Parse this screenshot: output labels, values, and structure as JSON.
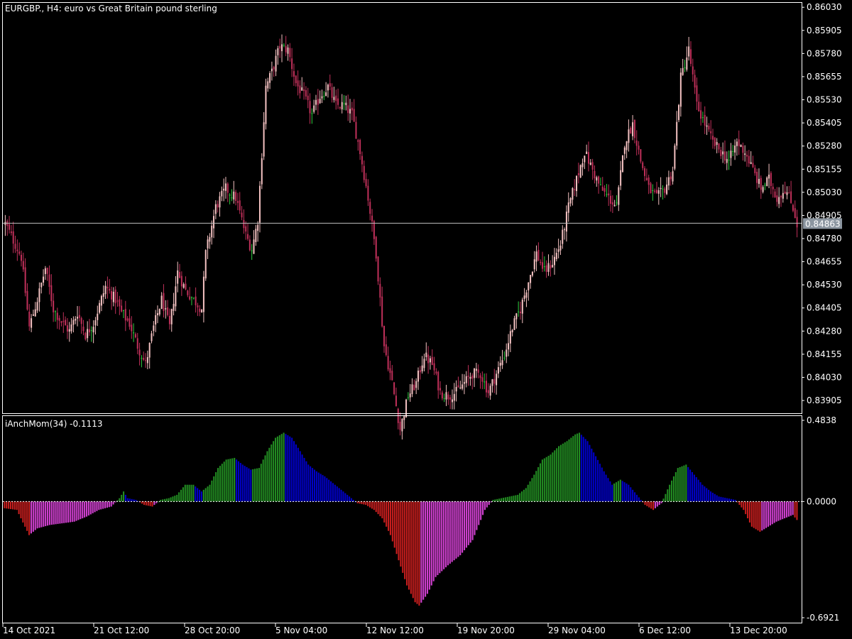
{
  "main_panel": {
    "title": "EURGBP., H4:  euro vs Great Britain pound sterling",
    "price_ticks": [
      "0.86030",
      "0.85905",
      "0.85780",
      "0.85655",
      "0.85530",
      "0.85405",
      "0.85280",
      "0.85155",
      "0.85030",
      "0.84905",
      "0.84780",
      "0.84655",
      "0.84530",
      "0.84405",
      "0.84280",
      "0.84155",
      "0.84030",
      "0.83905"
    ],
    "current_price": "0.84863"
  },
  "indicator_panel": {
    "title": "iAnchMom(34) -0.1113",
    "ticks": [
      "0.4838",
      "0.0000",
      "-0.6921"
    ]
  },
  "time_axis": {
    "labels": [
      "14 Oct 2021",
      "21 Oct 12:00",
      "28 Oct 20:00",
      "5 Nov 04:00",
      "12 Nov 12:00",
      "19 Nov 20:00",
      "29 Nov 04:00",
      "6 Dec 12:00",
      "13 Dec 20:00"
    ]
  },
  "colors": {
    "background": "#000000",
    "frame": "#ffffff",
    "candle_up": "#f4c2c2",
    "candle_down": "#c0305a",
    "candle_doji": "#2ecc40",
    "hist_green": "#228b22",
    "hist_blue": "#0000c8",
    "hist_red": "#c81e1e",
    "hist_magenta": "#d040d0",
    "price_line": "#c0c0c0",
    "price_label_bg": "#8c96a0"
  },
  "chart_data": [
    {
      "type": "candlestick",
      "title": "EURGBP., H4:  euro vs Great Britain pound sterling",
      "ylim": [
        0.8384,
        0.8605
      ],
      "current_price": 0.84863,
      "anchors_close": [
        [
          0,
          0.8486
        ],
        [
          8,
          0.8468
        ],
        [
          12,
          0.843
        ],
        [
          16,
          0.8445
        ],
        [
          20,
          0.8462
        ],
        [
          24,
          0.844
        ],
        [
          28,
          0.8433
        ],
        [
          32,
          0.8428
        ],
        [
          36,
          0.8438
        ],
        [
          40,
          0.8426
        ],
        [
          44,
          0.8432
        ],
        [
          50,
          0.8452
        ],
        [
          55,
          0.8445
        ],
        [
          58,
          0.8438
        ],
        [
          62,
          0.8432
        ],
        [
          66,
          0.842
        ],
        [
          70,
          0.841
        ],
        [
          74,
          0.843
        ],
        [
          78,
          0.8445
        ],
        [
          82,
          0.843
        ],
        [
          86,
          0.846
        ],
        [
          90,
          0.845
        ],
        [
          94,
          0.8445
        ],
        [
          98,
          0.844
        ],
        [
          100,
          0.847
        ],
        [
          105,
          0.8495
        ],
        [
          110,
          0.8505
        ],
        [
          115,
          0.85
        ],
        [
          120,
          0.848
        ],
        [
          123,
          0.8472
        ],
        [
          126,
          0.8488
        ],
        [
          130,
          0.856
        ],
        [
          133,
          0.8568
        ],
        [
          137,
          0.8582
        ],
        [
          141,
          0.858
        ],
        [
          145,
          0.8562
        ],
        [
          149,
          0.8555
        ],
        [
          153,
          0.8545
        ],
        [
          157,
          0.8555
        ],
        [
          161,
          0.856
        ],
        [
          165,
          0.855
        ],
        [
          169,
          0.855
        ],
        [
          173,
          0.8545
        ],
        [
          177,
          0.8525
        ],
        [
          181,
          0.85
        ],
        [
          185,
          0.847
        ],
        [
          189,
          0.842
        ],
        [
          193,
          0.84
        ],
        [
          197,
          0.8375
        ],
        [
          201,
          0.8393
        ],
        [
          205,
          0.84
        ],
        [
          209,
          0.8415
        ],
        [
          213,
          0.841
        ],
        [
          217,
          0.8395
        ],
        [
          221,
          0.8393
        ],
        [
          225,
          0.8395
        ],
        [
          229,
          0.84
        ],
        [
          233,
          0.8405
        ],
        [
          237,
          0.8405
        ],
        [
          241,
          0.8395
        ],
        [
          245,
          0.8405
        ],
        [
          249,
          0.8415
        ],
        [
          253,
          0.843
        ],
        [
          257,
          0.844
        ],
        [
          261,
          0.8455
        ],
        [
          265,
          0.847
        ],
        [
          269,
          0.846
        ],
        [
          273,
          0.8465
        ],
        [
          277,
          0.8475
        ],
        [
          281,
          0.8495
        ],
        [
          285,
          0.851
        ],
        [
          289,
          0.8525
        ],
        [
          293,
          0.8515
        ],
        [
          297,
          0.8505
        ],
        [
          301,
          0.85
        ],
        [
          305,
          0.8495
        ],
        [
          309,
          0.853
        ],
        [
          313,
          0.854
        ],
        [
          317,
          0.852
        ],
        [
          321,
          0.8505
        ],
        [
          325,
          0.85
        ],
        [
          329,
          0.8505
        ],
        [
          333,
          0.8515
        ],
        [
          337,
          0.8565
        ],
        [
          341,
          0.858
        ],
        [
          345,
          0.855
        ],
        [
          349,
          0.854
        ],
        [
          353,
          0.853
        ],
        [
          357,
          0.8525
        ],
        [
          361,
          0.852
        ],
        [
          365,
          0.853
        ],
        [
          369,
          0.8525
        ],
        [
          373,
          0.8515
        ],
        [
          377,
          0.8505
        ],
        [
          381,
          0.851
        ],
        [
          385,
          0.85
        ],
        [
          389,
          0.8505
        ],
        [
          393,
          0.8495
        ],
        [
          395,
          0.8486
        ]
      ]
    },
    {
      "type": "bar",
      "title": "iAnchMom(34) -0.1113",
      "ylim": [
        -0.6921,
        0.4838
      ],
      "last_value": -0.1113,
      "anchors_value": [
        [
          0,
          -0.04
        ],
        [
          6,
          -0.05
        ],
        [
          12,
          -0.2
        ],
        [
          16,
          -0.16
        ],
        [
          22,
          -0.14
        ],
        [
          28,
          -0.13
        ],
        [
          34,
          -0.12
        ],
        [
          40,
          -0.09
        ],
        [
          46,
          -0.05
        ],
        [
          52,
          -0.03
        ],
        [
          56,
          0.02
        ],
        [
          58,
          0.06
        ],
        [
          60,
          0.02
        ],
        [
          64,
          0.01
        ],
        [
          68,
          -0.02
        ],
        [
          72,
          -0.03
        ],
        [
          76,
          0.01
        ],
        [
          80,
          0.02
        ],
        [
          84,
          0.04
        ],
        [
          88,
          0.1
        ],
        [
          92,
          0.1
        ],
        [
          96,
          0.06
        ],
        [
          100,
          0.1
        ],
        [
          104,
          0.2
        ],
        [
          108,
          0.25
        ],
        [
          112,
          0.26
        ],
        [
          116,
          0.22
        ],
        [
          120,
          0.19
        ],
        [
          124,
          0.2
        ],
        [
          128,
          0.3
        ],
        [
          132,
          0.38
        ],
        [
          136,
          0.41
        ],
        [
          140,
          0.38
        ],
        [
          144,
          0.3
        ],
        [
          148,
          0.22
        ],
        [
          152,
          0.18
        ],
        [
          156,
          0.15
        ],
        [
          160,
          0.11
        ],
        [
          164,
          0.07
        ],
        [
          168,
          0.03
        ],
        [
          172,
          -0.01
        ],
        [
          176,
          -0.02
        ],
        [
          180,
          -0.05
        ],
        [
          184,
          -0.1
        ],
        [
          188,
          -0.2
        ],
        [
          192,
          -0.35
        ],
        [
          196,
          -0.5
        ],
        [
          200,
          -0.6
        ],
        [
          202,
          -0.62
        ],
        [
          206,
          -0.55
        ],
        [
          210,
          -0.45
        ],
        [
          216,
          -0.38
        ],
        [
          222,
          -0.32
        ],
        [
          228,
          -0.23
        ],
        [
          234,
          -0.05
        ],
        [
          238,
          0.01
        ],
        [
          242,
          0.02
        ],
        [
          246,
          0.03
        ],
        [
          250,
          0.04
        ],
        [
          254,
          0.08
        ],
        [
          258,
          0.16
        ],
        [
          262,
          0.25
        ],
        [
          266,
          0.28
        ],
        [
          270,
          0.33
        ],
        [
          274,
          0.36
        ],
        [
          278,
          0.4
        ],
        [
          280,
          0.41
        ],
        [
          284,
          0.36
        ],
        [
          288,
          0.27
        ],
        [
          292,
          0.18
        ],
        [
          296,
          0.1
        ],
        [
          300,
          0.13
        ],
        [
          304,
          0.1
        ],
        [
          308,
          0.04
        ],
        [
          312,
          -0.02
        ],
        [
          316,
          -0.05
        ],
        [
          320,
          -0.01
        ],
        [
          324,
          0.1
        ],
        [
          328,
          0.2
        ],
        [
          332,
          0.22
        ],
        [
          336,
          0.16
        ],
        [
          340,
          0.1
        ],
        [
          344,
          0.06
        ],
        [
          348,
          0.03
        ],
        [
          352,
          0.02
        ],
        [
          356,
          0.01
        ],
        [
          360,
          -0.05
        ],
        [
          364,
          -0.15
        ],
        [
          368,
          -0.18
        ],
        [
          372,
          -0.15
        ],
        [
          376,
          -0.12
        ],
        [
          380,
          -0.1
        ],
        [
          384,
          -0.08
        ],
        [
          386,
          -0.11
        ]
      ]
    }
  ]
}
